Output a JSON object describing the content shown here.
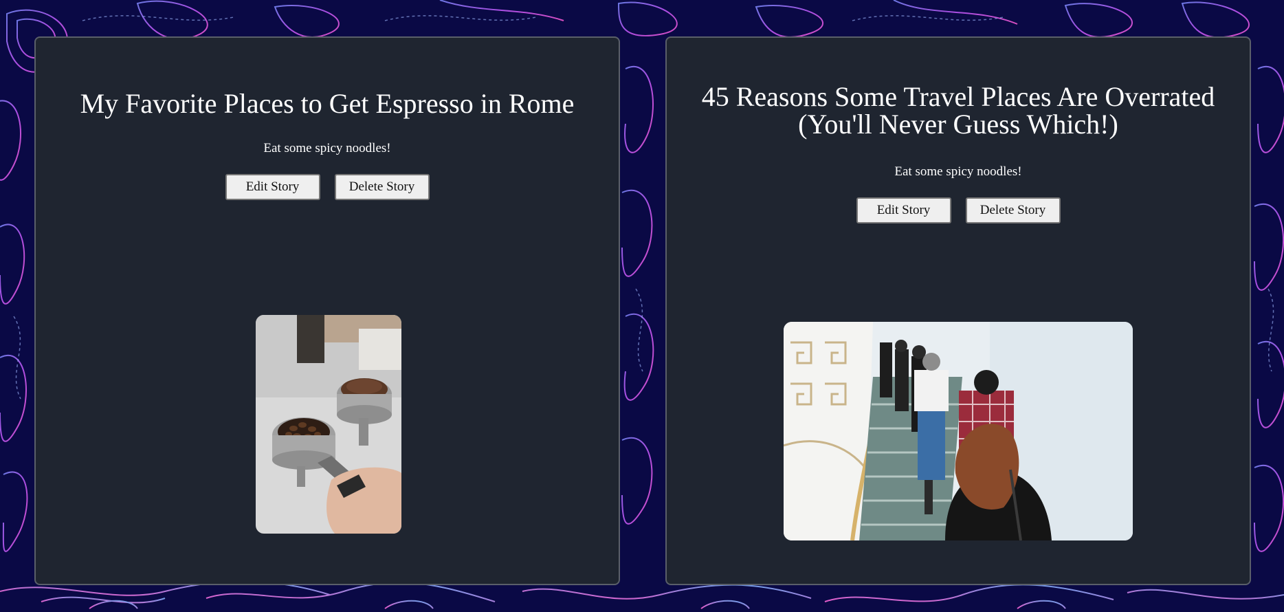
{
  "stories": [
    {
      "title": "My Favorite Places to Get Espresso in Rome",
      "description": "Eat some spicy noodles!",
      "edit_label": "Edit Story",
      "delete_label": "Delete Story",
      "image_icon": "espresso-portafilter-photo"
    },
    {
      "title": "45 Reasons Some Travel Places Are Overrated (You'll Never Guess Which!)",
      "description": "Eat some spicy noodles!",
      "edit_label": "Edit Story",
      "delete_label": "Delete Story",
      "image_icon": "people-climbing-stairs-photo"
    }
  ],
  "colors": {
    "page_background": "#0b0a4a",
    "card_background": "#1f2530",
    "card_border": "#5a5f69",
    "text": "#ffffff",
    "button_background": "#efefef"
  }
}
